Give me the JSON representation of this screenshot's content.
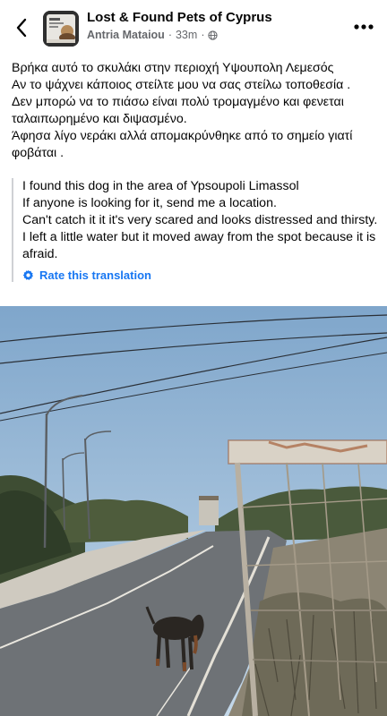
{
  "header": {
    "group_name": "Lost & Found Pets of Cyprus",
    "author": "Antria Mataiou",
    "time": "33m",
    "separator": "·",
    "icons": {
      "back": "back-arrow-icon",
      "audience": "globe-icon",
      "more": "more-dots-icon"
    }
  },
  "post": {
    "greek_lines": [
      "Βρήκα αυτό το σκυλάκι στην περιοχή Υψουπολη Λεμεσός",
      "Αν το ψάχνει κάποιος στείλτε μου να σας στείλω τοποθεσία .",
      "Δεν μπορώ να το πιάσω είναι πολύ τρομαγμένο και φενεται ταλαιπωρημένο και διψασμένο.",
      "Άφησα λίγο νεράκι αλλά απομακρύνθηκε από το σημείο γιατί φοβάται ."
    ]
  },
  "translation": {
    "lines": [
      "I found this dog in the area of Ypsoupoli Limassol",
      "If anyone is looking for it, send me a location.",
      "Can't catch it it it's very scared and looks distressed and thirsty.",
      "I left a little water but it moved away from the spot because it is afraid."
    ],
    "rate_label": "Rate this translation"
  },
  "colors": {
    "link": "#1877f2",
    "secondary_text": "#65676b",
    "sky": "#a9c6df",
    "road": "#6e7276"
  }
}
